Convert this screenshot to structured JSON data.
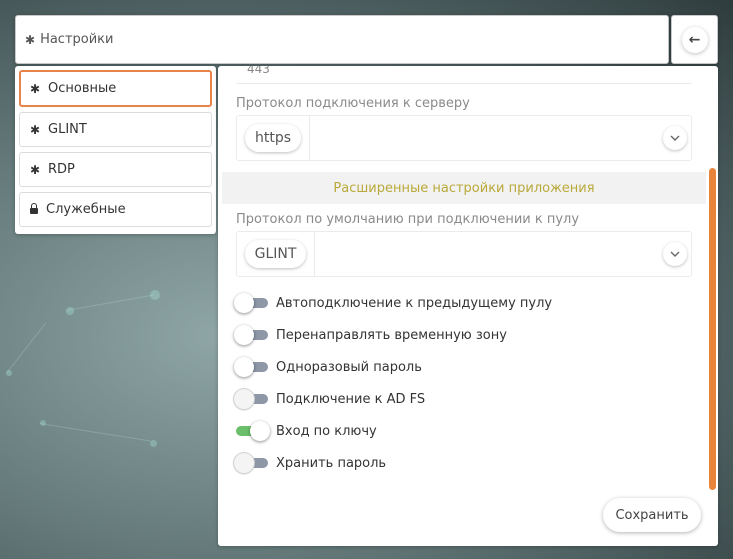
{
  "header": {
    "title": "Настройки",
    "icon": "gear-icon"
  },
  "back_button": {
    "icon": "arrow-left-icon"
  },
  "sidebar": {
    "items": [
      {
        "label": "Основные",
        "icon": "gear-icon",
        "active": true
      },
      {
        "label": "GLINT",
        "icon": "gear-icon",
        "active": false
      },
      {
        "label": "RDP",
        "icon": "gear-icon",
        "active": false
      },
      {
        "label": "Служебные",
        "icon": "lock-icon",
        "active": false
      }
    ]
  },
  "main": {
    "previous_field_value": "443",
    "server_protocol": {
      "label": "Протокол подключения к серверу",
      "value": "https"
    },
    "advanced_section_title": "Расширенные настройки приложения",
    "pool_protocol": {
      "label": "Протокол по умолчанию при подключении к пулу",
      "value": "GLINT"
    },
    "toggles": [
      {
        "label": "Автоподключение к предыдущему пулу",
        "on": false,
        "enabled": true
      },
      {
        "label": "Перенаправлять временную зону",
        "on": false,
        "enabled": true
      },
      {
        "label": "Одноразовый пароль",
        "on": false,
        "enabled": true
      },
      {
        "label": "Подключение к AD FS",
        "on": false,
        "enabled": false
      },
      {
        "label": "Вход по ключу",
        "on": true,
        "enabled": true
      },
      {
        "label": "Хранить пароль",
        "on": false,
        "enabled": false
      }
    ],
    "save_label": "Сохранить"
  },
  "colors": {
    "accent": "#e8834a",
    "section_text": "#b9a93a",
    "toggle_on": "#6bbf6b",
    "toggle_off": "#8d97a6"
  }
}
